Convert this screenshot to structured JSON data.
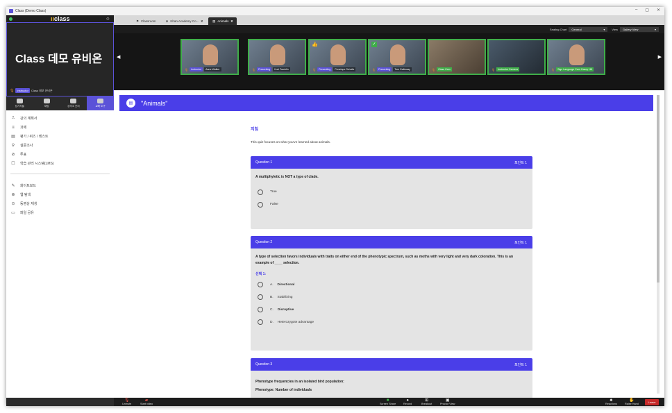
{
  "window": {
    "title": "Class (Demo Class)",
    "controls": [
      "–",
      "▢",
      "✕"
    ]
  },
  "left_panel": {
    "brand": "class",
    "self_name_large": "Class 데모 유비온",
    "self_role": "Instructor",
    "self_name_small": "Class 데모 유비온",
    "toolbar": [
      {
        "label": "참가자들",
        "icon": "participants-icon",
        "active": false
      },
      {
        "label": "채팅",
        "icon": "chat-icon",
        "active": false
      },
      {
        "label": "강의소 관리",
        "icon": "classroom-manage-icon",
        "active": false
      },
      {
        "label": "교육 도구",
        "icon": "teaching-tools-icon",
        "active": true
      }
    ],
    "menu_primary": [
      {
        "label": "강의 계획서",
        "icon": "syllabus-icon"
      },
      {
        "label": "과제",
        "icon": "assignment-icon"
      },
      {
        "label": "평가 / 퀴즈 / 테스트",
        "icon": "quiz-icon"
      },
      {
        "label": "설문조사",
        "icon": "survey-icon"
      },
      {
        "label": "투표",
        "icon": "poll-icon"
      },
      {
        "label": "학습 관리 시스템(LMS)",
        "icon": "lms-icon"
      }
    ],
    "menu_secondary": [
      {
        "label": "화이트보드",
        "icon": "whiteboard-icon"
      },
      {
        "label": "웹 탐색",
        "icon": "web-browse-icon"
      },
      {
        "label": "동영상 재생",
        "icon": "video-play-icon"
      },
      {
        "label": "파일 공유",
        "icon": "file-share-icon"
      }
    ]
  },
  "tabs": [
    {
      "label": "Classroom",
      "close": "",
      "active": false
    },
    {
      "label": "Khan Academy Co...",
      "close": "x",
      "active": false
    },
    {
      "label": "Animals",
      "close": "x",
      "active": true
    }
  ],
  "controls": {
    "seating_label": "Seating Chart",
    "seating_value": "General",
    "view_label": "View",
    "view_value": "Gallery View"
  },
  "gallery": [
    {
      "role": "Instructor",
      "name": "Anne Walker",
      "extra": ""
    },
    {
      "role": "Presenting",
      "name": "Kurt Franklin",
      "extra": ""
    },
    {
      "role": "Presenting",
      "name": "Penelope Schultz",
      "extra": "👍"
    },
    {
      "role": "Presenting",
      "name": "Tom Galloway",
      "extra": "✓"
    },
    {
      "role": "",
      "name": "Class Cam",
      "extra": ""
    },
    {
      "role": "",
      "name": "Instructor Camera",
      "extra": ""
    },
    {
      "role": "",
      "name": "Sign Language Cam  Casey Hill",
      "extra": ""
    }
  ],
  "content": {
    "title": "\"Animals\"",
    "instructions_title": "지침",
    "instructions_text": "This quiz focuses on what you've learned about animals.",
    "questions": [
      {
        "header": "Question 1",
        "points": "포인트 1",
        "text": "A multiphyletic is NOT a type of clade.",
        "subheader": "",
        "options": [
          {
            "letter": "",
            "text": "True",
            "bold": false
          },
          {
            "letter": "",
            "text": "False",
            "bold": false
          }
        ]
      },
      {
        "header": "Question 2",
        "points": "포인트 1",
        "text": "A type of selection favors individuals with traits on either end of the phenotypic spectrum, such as moths with very light and very dark coloration. This is an example of ____ selection.",
        "subheader": "선택 1:",
        "options": [
          {
            "letter": "A.",
            "text": "Directional",
            "bold": true
          },
          {
            "letter": "B.",
            "text": "Stabilizing",
            "bold": false
          },
          {
            "letter": "C.",
            "text": "Disruptive",
            "bold": true
          },
          {
            "letter": "D.",
            "text": "Heterozygote advantage",
            "bold": false
          }
        ]
      },
      {
        "header": "Question 3",
        "points": "포인트 1",
        "text": "Phenotype frequencies in an isolated bird population:",
        "text2": "Phenotype: Number of individuals",
        "subheader": "",
        "options": []
      }
    ]
  },
  "bottom_bar": {
    "unmute": "Unmute",
    "start_video": "Start video",
    "screen_share": "Screen Share",
    "record": "Record",
    "breakout": "Breakout",
    "proctor": "Proctor View",
    "reactions": "Reactions",
    "raise_hand": "Raise Hand",
    "leave": "Leave"
  }
}
